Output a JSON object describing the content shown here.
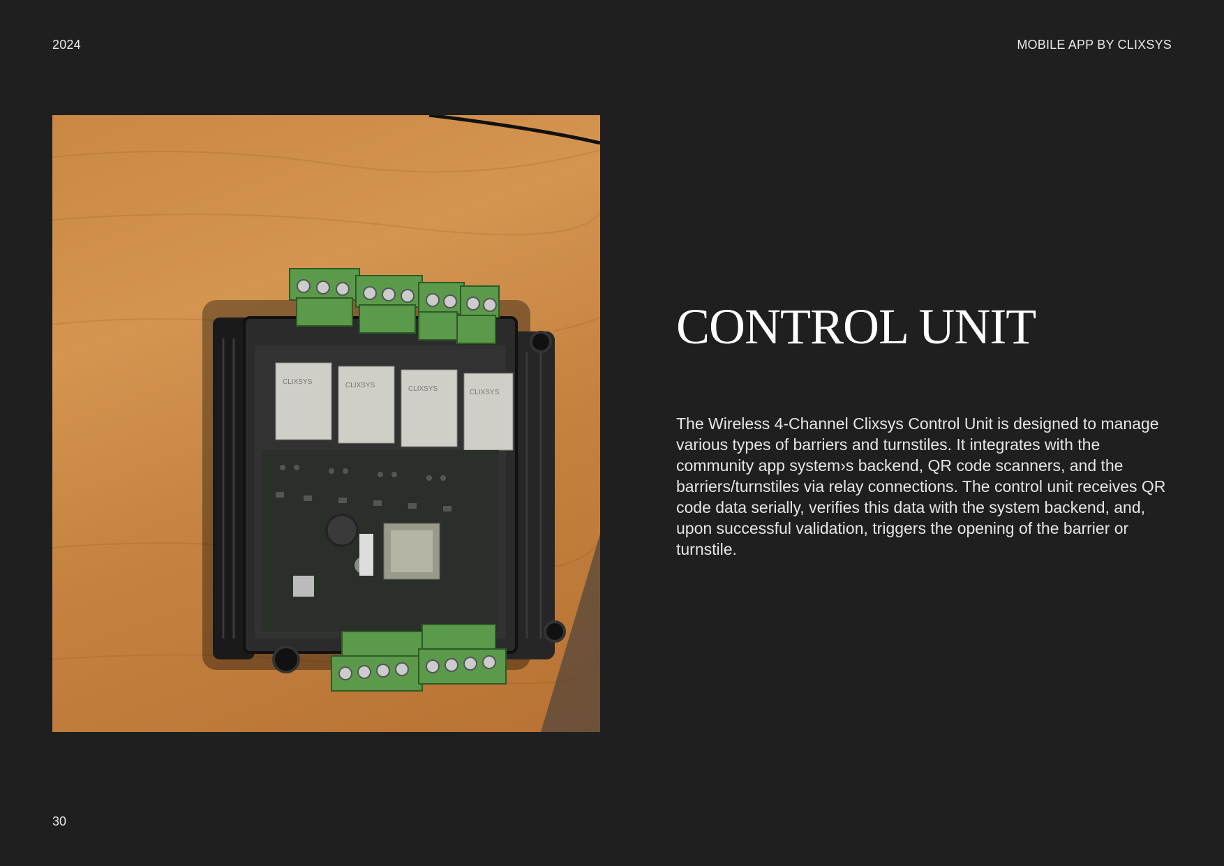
{
  "header": {
    "year": "2024",
    "brand": "MOBILE APP BY CLIXSYS"
  },
  "main": {
    "title": "CONTROL UNIT",
    "description": "The Wireless 4-Channel Clixsys Control Unit is designed to manage various types of barriers and turnstiles. It integrates with the community app system›s backend, QR code scanners, and the barriers/turnstiles via relay connections. The control unit receives QR code data serially, verifies this data with the system backend, and, upon successful validation, triggers the opening of the barrier or turnstile.",
    "photo": {
      "subject": "control-unit-device-photo",
      "relay_label": "CLIXSYS"
    }
  },
  "footer": {
    "page_number": "30"
  },
  "colors": {
    "background": "#1f1f1f",
    "text": "#ffffff",
    "terminal_green": "#5a9a4a",
    "wood": "#c98843"
  }
}
